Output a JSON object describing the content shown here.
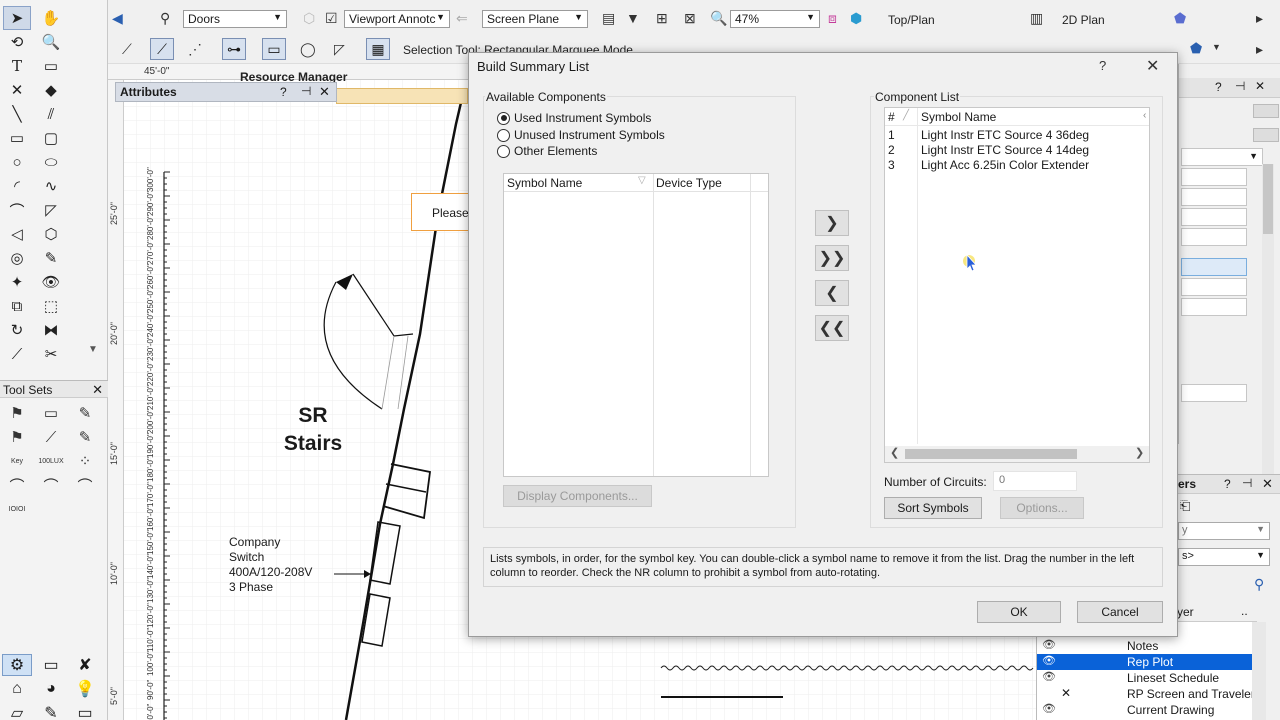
{
  "toolbar": {
    "class_value": "Doors",
    "layer_value": "Viewport Annotc",
    "plane_value": "Screen Plane",
    "zoom_value": "47%",
    "view_value": "Top/Plan",
    "render_value": "2D Plan",
    "mode_text": "Selection Tool: Rectangular Marquee Mode"
  },
  "canvas": {
    "ruler_top_label": "45'-0\"",
    "ruler_left_labels": [
      "25'-0\"",
      "20'-0\"",
      "15'-0\"",
      "10'-0\"",
      "5'-0\""
    ],
    "scale_labels": [
      "300'-0\"",
      "290'-0\"",
      "280'-0\"",
      "270'-0\"",
      "260'-0\"",
      "250'-0\"",
      "240'-0\"",
      "230'-0\"",
      "220'-0\"",
      "210'-0\"",
      "200'-0\"",
      "190'-0\"",
      "180'-0\"",
      "170'-0\"",
      "160'-0\"",
      "150'-0\"",
      "140'-0\"",
      "130'-0\"",
      "120'-0\"",
      "110'-0\"",
      "100'-0\"",
      "90'-0\"",
      "80'-0\""
    ],
    "stairs_line1": "SR",
    "stairs_line2": "Stairs",
    "switch_lines": [
      "Company",
      "Switch",
      "400A/120-208V",
      "3 Phase"
    ],
    "please_text": "Please"
  },
  "attributes": {
    "title": "Attributes",
    "help": "?",
    "resource_manager": "Resource Manager"
  },
  "toolsets": {
    "title": "Tool Sets"
  },
  "navigation": {
    "title": "ers",
    "help": "?",
    "dd1": "y",
    "dd2": "s>",
    "column_name": "yer",
    "column_more": ".."
  },
  "layers": [
    {
      "name": "Notes",
      "visible": true,
      "active": false
    },
    {
      "name": "Rep Plot",
      "visible": true,
      "active": true
    },
    {
      "name": "Lineset Schedule",
      "visible": true,
      "active": false
    },
    {
      "name": "RP Screen and Traveler",
      "visible": false,
      "active": false
    },
    {
      "name": "Current Drawing",
      "visible": true,
      "active": false
    }
  ],
  "dialog": {
    "title": "Build Summary List",
    "help": "?",
    "available_label": "Available Components",
    "radios": [
      {
        "label": "Used Instrument Symbols",
        "selected": true
      },
      {
        "label": "Unused Instrument Symbols",
        "selected": false
      },
      {
        "label": "Other Elements",
        "selected": false
      }
    ],
    "avail_col_symbol": "Symbol Name",
    "avail_col_device": "Device Type",
    "display_button": "Display Components...",
    "component_label": "Component List",
    "comp_col_num": "#",
    "comp_col_name": "Symbol Name",
    "components": [
      {
        "num": "1",
        "name": "Light Instr ETC Source 4 36deg"
      },
      {
        "num": "2",
        "name": "Light Instr ETC Source 4 14deg"
      },
      {
        "num": "3",
        "name": "Light Acc 6.25in Color Extender"
      }
    ],
    "circuits_label": "Number of Circuits:",
    "circuits_value": "0",
    "sort_button": "Sort Symbols",
    "options_button": "Options...",
    "help_text": "Lists symbols, in order, for the symbol key.  You can double-click a symbol name to remove it from the list.  Drag the number in the left column to reorder.  Check the NR column to prohibit a symbol from auto-rotating.",
    "ok_button": "OK",
    "cancel_button": "Cancel"
  },
  "colors": {
    "accent": "#0a62d8",
    "highlight_box": "#f0a040"
  }
}
